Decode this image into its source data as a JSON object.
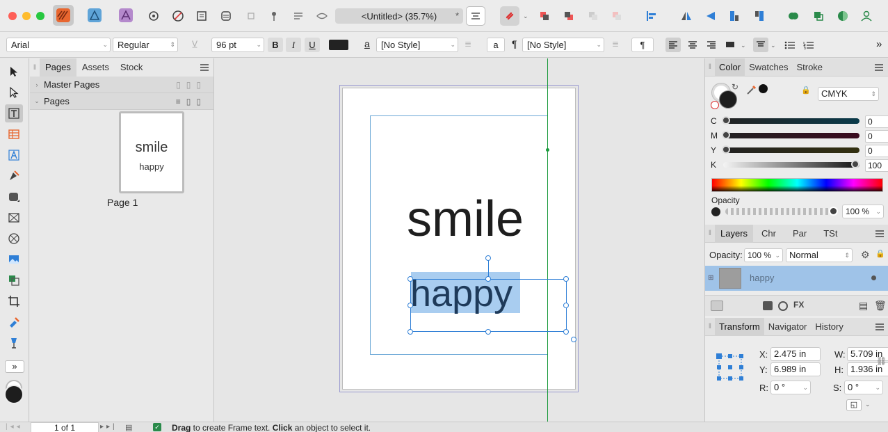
{
  "window": {
    "doc_title": "<Untitled> (35.7%)",
    "modified_mark": "*"
  },
  "context": {
    "font_family": "Arial",
    "font_style": "Regular",
    "font_size": "96 pt",
    "bold": "B",
    "italic": "I",
    "underline": "U",
    "char_style_glyph": "a",
    "char_style": "[No Style]",
    "para_glyph_a": "a",
    "pilcrow": "¶",
    "para_style": "[No Style]",
    "pilcrow2": "¶",
    "more": "»"
  },
  "pages_panel": {
    "tabs": [
      "Pages",
      "Assets",
      "Stock"
    ],
    "master_pages": "Master Pages",
    "pages": "Pages",
    "thumb_big": "smile",
    "thumb_small": "happy",
    "page_label": "Page 1"
  },
  "canvas": {
    "big_text": "smile",
    "small_text": "happy"
  },
  "color_panel": {
    "tabs": [
      "Color",
      "Swatches",
      "Stroke"
    ],
    "model": "CMYK",
    "channels": [
      {
        "label": "C",
        "value": "0"
      },
      {
        "label": "M",
        "value": "0"
      },
      {
        "label": "Y",
        "value": "0"
      },
      {
        "label": "K",
        "value": "100"
      }
    ],
    "opacity_label": "Opacity",
    "opacity_value": "100 %"
  },
  "layers_panel": {
    "tabs": [
      "Layers",
      "Chr",
      "Par",
      "TSt"
    ],
    "opacity_label": "Opacity:",
    "opacity_value": "100 %",
    "blend_mode": "Normal",
    "layer_name": "happy"
  },
  "transform_panel": {
    "tabs": [
      "Transform",
      "Navigator",
      "History"
    ],
    "x_label": "X:",
    "x_value": "2.475 in",
    "y_label": "Y:",
    "y_value": "6.989 in",
    "w_label": "W:",
    "w_value": "5.709 in",
    "h_label": "H:",
    "h_value": "1.936 in",
    "r_label": "R:",
    "r_value": "0 °",
    "s_label": "S:",
    "s_value": "0 °"
  },
  "status": {
    "page_of": "1 of 1",
    "hint_bold1": "Drag",
    "hint_text1": " to create Frame text. ",
    "hint_bold2": "Click",
    "hint_text2": " an object to select it."
  },
  "colors": {
    "accent_blue": "#2f7fd6",
    "selection_blue": "#a9cdf0",
    "guide_green": "#1a9a3c",
    "brand_orange": "#e8662f"
  }
}
